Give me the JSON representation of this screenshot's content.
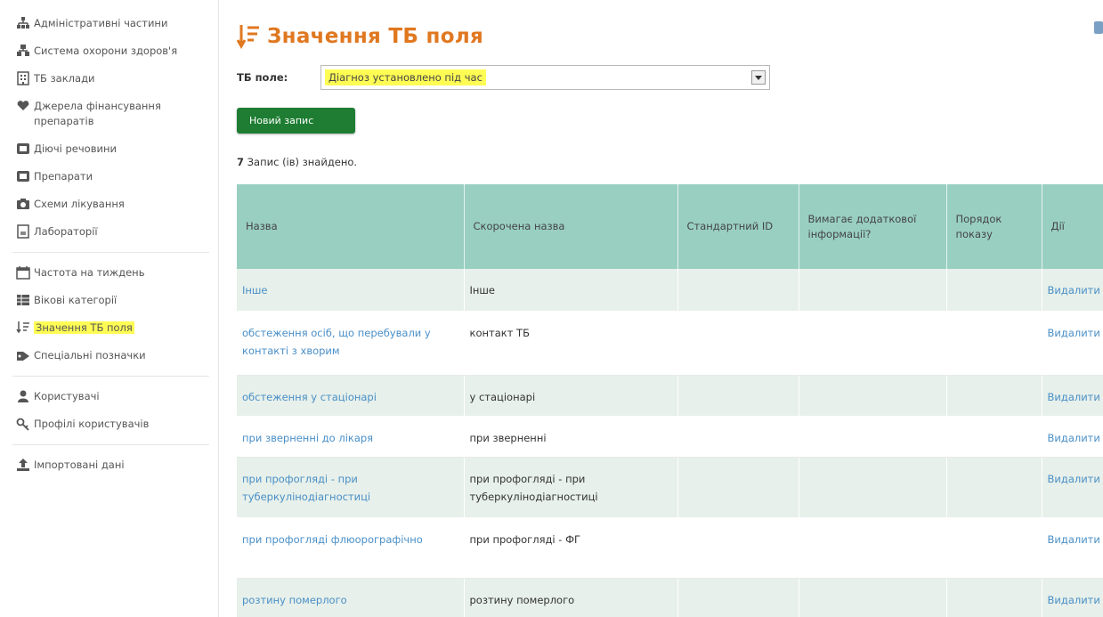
{
  "sidebar": {
    "items": [
      {
        "label": "Адміністративні частини",
        "icon": "sitemap-icon"
      },
      {
        "label": "Система охорони здоров'я",
        "icon": "hierarchy-icon"
      },
      {
        "label": "ТБ заклади",
        "icon": "building-icon"
      },
      {
        "label": "Джерела фінансування препаратів",
        "icon": "hand-heart-icon"
      },
      {
        "label": "Діючі речовини",
        "icon": "pill-icon"
      },
      {
        "label": "Препарати",
        "icon": "medicine-icon"
      },
      {
        "label": "Схеми лікування",
        "icon": "scheme-icon"
      },
      {
        "label": "Лабораторії",
        "icon": "lab-icon"
      },
      {
        "label": "Частота на тиждень",
        "icon": "calendar-icon"
      },
      {
        "label": "Вікові категорії",
        "icon": "table-icon"
      },
      {
        "label": "Значення ТБ поля",
        "icon": "sort-icon",
        "active": true
      },
      {
        "label": "Спеціальні позначки",
        "icon": "tag-icon"
      },
      {
        "label": "Користувачі",
        "icon": "users-icon"
      },
      {
        "label": "Профілі користувачів",
        "icon": "key-icon"
      },
      {
        "label": "Імпортовані дані",
        "icon": "upload-icon"
      }
    ]
  },
  "page": {
    "title": "Значення ТБ поля",
    "field_label": "ТБ поле:",
    "field_value": "Діагноз установлено під час",
    "new_button": "Новий запис",
    "records_count": "7",
    "records_text": "Запис (ів) знайдено."
  },
  "table": {
    "headers": [
      "Назва",
      "Скорочена назва",
      "Стандартний ID",
      "Вимагає додаткової інформації?",
      "Порядок показу",
      "Дії"
    ],
    "rows": [
      {
        "name": "Інше",
        "short": "Інше",
        "action": "Видалити"
      },
      {
        "name": "обстеження осіб, що перебували у контакті з хворим",
        "short": "контакт ТБ",
        "action": "Видалити"
      },
      {
        "name": "обстеження у стаціонарі",
        "short": "у стаціонарі",
        "action": "Видалити"
      },
      {
        "name": "при зверненні до лікаря",
        "short": "при зверненні",
        "action": "Видалити"
      },
      {
        "name": "при профогляді - при туберкулінодіагностиці",
        "short": "при профогляді - при туберкулінодіагностиці",
        "action": "Видалити"
      },
      {
        "name": "при профогляді флюорографічно",
        "short": "при профогляді - ФГ",
        "action": "Видалити"
      },
      {
        "name": "розтину померлого",
        "short": "розтину померлого",
        "action": "Видалити"
      }
    ]
  },
  "colors": {
    "title": "#e07820",
    "table_header": "#99cfc1",
    "row_alt": "#e7f0ea",
    "link": "#4a8fc7",
    "button": "#1e7d32",
    "highlight": "#fffd54"
  }
}
